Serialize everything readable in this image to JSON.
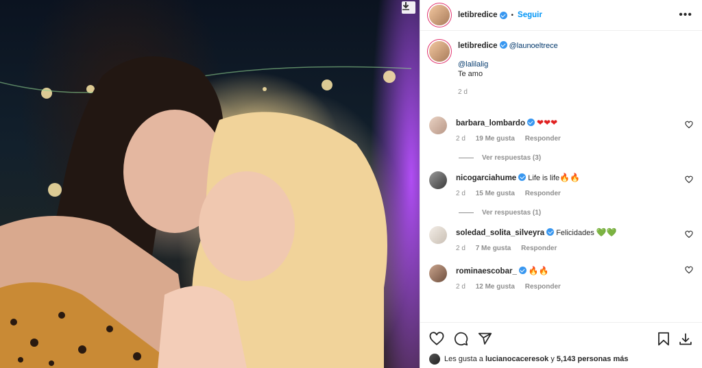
{
  "post": {
    "author": "letibredice",
    "follow_label": "Seguir",
    "separator": "•",
    "more_label": "•••"
  },
  "caption": {
    "author": "letibredice",
    "mention_1": "@launoeltrece",
    "mention_2": "@lalilalig",
    "text": "Te amo",
    "time": "2 d"
  },
  "comments": [
    {
      "user": "barbara_lombardo",
      "text": "",
      "emoji": "❤❤❤",
      "emoji_color": "red",
      "time": "2 d",
      "likes": "19 Me gusta",
      "reply": "Responder",
      "replies": "Ver respuestas (3)"
    },
    {
      "user": "nicogarciahume",
      "text": "Life is life",
      "emoji": "🔥🔥",
      "emoji_color": "orange",
      "time": "2 d",
      "likes": "15 Me gusta",
      "reply": "Responder",
      "replies": "Ver respuestas (1)"
    },
    {
      "user": "soledad_solita_silveyra",
      "text": "Felicidades",
      "emoji": "💚💚",
      "emoji_color": "green",
      "time": "2 d",
      "likes": "7 Me gusta",
      "reply": "Responder"
    },
    {
      "user": "rominaescobar_",
      "text": "",
      "emoji": "🔥🔥",
      "emoji_color": "orange",
      "time": "2 d",
      "likes": "12 Me gusta",
      "reply": "Responder"
    }
  ],
  "likes": {
    "prefix": "Les gusta a",
    "user": "lucianocaceresok",
    "and": "y",
    "count": "5,143 personas más"
  },
  "icons": [
    "download-icon",
    "like-icon",
    "comment-icon",
    "share-icon",
    "bookmark-icon",
    "save-icon",
    "heart-icon"
  ],
  "colors": {
    "accent": "#0095f6",
    "verified": "#3897f0",
    "heart": "#e02020"
  }
}
